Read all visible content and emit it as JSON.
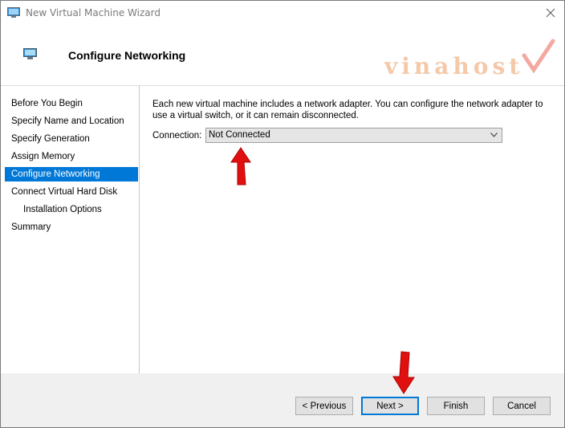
{
  "window": {
    "title": "New Virtual Machine Wizard",
    "icon": "vm-wizard-icon"
  },
  "header": {
    "title": "Configure Networking",
    "watermark": "vinahost",
    "watermark_color": "#f4c8a8"
  },
  "nav": {
    "items": [
      {
        "label": "Before You Begin"
      },
      {
        "label": "Specify Name and Location"
      },
      {
        "label": "Specify Generation"
      },
      {
        "label": "Assign Memory"
      },
      {
        "label": "Configure Networking",
        "selected": true
      },
      {
        "label": "Connect Virtual Hard Disk"
      },
      {
        "label": "Installation Options",
        "sub": true
      },
      {
        "label": "Summary"
      }
    ],
    "selected_color": "#0078d7"
  },
  "content": {
    "description": "Each new virtual machine includes a network adapter. You can configure the network adapter to use a virtual switch, or it can remain disconnected.",
    "connection_label": "Connection:",
    "connection_value": "Not Connected"
  },
  "buttons": {
    "previous": "< Previous",
    "next": "Next >",
    "finish": "Finish",
    "cancel": "Cancel"
  },
  "annotations": {
    "arrow_color": "#e01010"
  }
}
